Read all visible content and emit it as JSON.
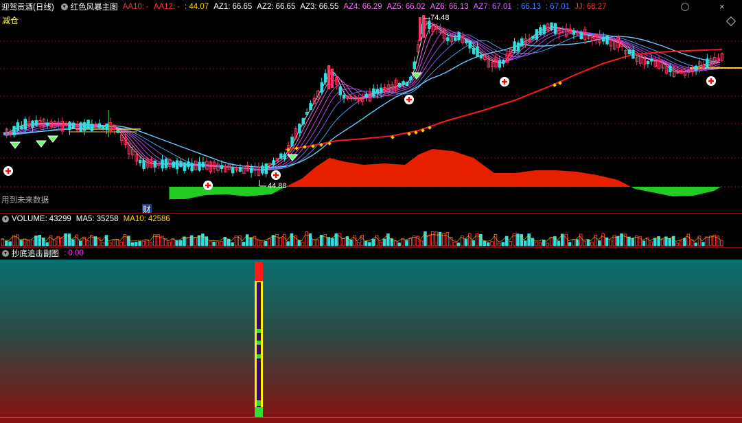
{
  "main_panel": {
    "stock_name": "迎驾贡酒(日线)",
    "indicator_name": "红色风暴主图",
    "values": [
      {
        "label": "AA10:",
        "value": "-",
        "color": "#ff3030"
      },
      {
        "label": "AA12:",
        "value": "-",
        "color": "#ff3030"
      },
      {
        "label": "",
        "value": ": 44.07",
        "color": "#ffd700"
      },
      {
        "label": "AZ1:",
        "value": "66.65",
        "color": "#ffffff"
      },
      {
        "label": "AZ2:",
        "value": "66.65",
        "color": "#ffffff"
      },
      {
        "label": "AZ3:",
        "value": "66.55",
        "color": "#ffffff"
      },
      {
        "label": "AZ4:",
        "value": "66.29",
        "color": "#ff66ff"
      },
      {
        "label": "AZ5:",
        "value": "66.02",
        "color": "#ff66ff"
      },
      {
        "label": "AZ6:",
        "value": "66.13",
        "color": "#ff66ff"
      },
      {
        "label": "AZ7:",
        "value": "67.01",
        "color": "#cc66ff"
      },
      {
        "label": "",
        "value": ": 66.13",
        "color": "#4d7fff"
      },
      {
        "label": "",
        "value": ": 67.01",
        "color": "#4d7fff"
      },
      {
        "label": "JJ:",
        "value": "68.27",
        "color": "#ff3030"
      }
    ],
    "tag_reduce": "减仓",
    "note_future_data": "用到未来数据",
    "tag_finance": "财",
    "high_label": "74.48",
    "low_label": "44.88"
  },
  "volume_panel": {
    "items": [
      {
        "label": "VOLUME:",
        "value": "43299",
        "color": "#ffffff"
      },
      {
        "label": "MA5:",
        "value": "35258",
        "color": "#ffffff"
      },
      {
        "label": "MA10:",
        "value": "42586",
        "color": "#ffd700"
      }
    ]
  },
  "sub_panel": {
    "title": "抄底追击副图",
    "value": ": 0.00",
    "value_color": "#ff33ff"
  },
  "chart_data": {
    "type": "candlestick",
    "title": "迎驾贡酒(日线)",
    "price_high": 74.48,
    "price_low": 44.88,
    "colors": {
      "up": "#ff3366",
      "down": "#33dddd",
      "red_line": "#ff1a1a",
      "energy_pos": "#e82000",
      "energy_neg": "#22cc22"
    }
  }
}
